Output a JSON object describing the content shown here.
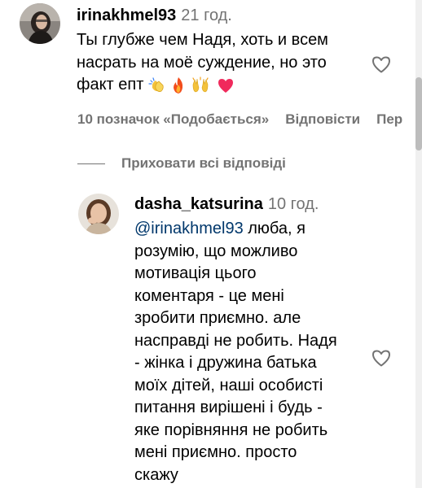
{
  "comments": [
    {
      "username": "irinakhmel93",
      "time": "21 год.",
      "lines": [
        "Ты глубже чем Надя, хоть и всем",
        "насрать на моё суждение, но это",
        "факт епт"
      ],
      "emojis": [
        "clapping-hands-emoji",
        "fire-emoji",
        "raising-hands-emoji",
        "heart-emoji"
      ],
      "likes": "10 позначок «Подобається»",
      "reply_label": "Відповісти",
      "more_label": "Пер"
    },
    {
      "username": "dasha_katsurina",
      "time": "10 год.",
      "mention": "@irinakhmel93",
      "first_line_rest": " люба, я",
      "lines": [
        "розумію, що можливо",
        "мотивація цього",
        "коментаря - це мені",
        "зробити приємно. але",
        "насправді не робить. Надя",
        "- жінка і дружина батька",
        "моїх дітей, наші особисті",
        "питання вирішені і будь -",
        "яке порівняння не робить",
        "мені приємно. просто",
        "скажу"
      ]
    }
  ],
  "replies": {
    "hide_label": "Приховати всі відповіді"
  },
  "colors": {
    "secondary_text": "#737373",
    "mention": "#00376b",
    "heart_outline": "#737373"
  }
}
